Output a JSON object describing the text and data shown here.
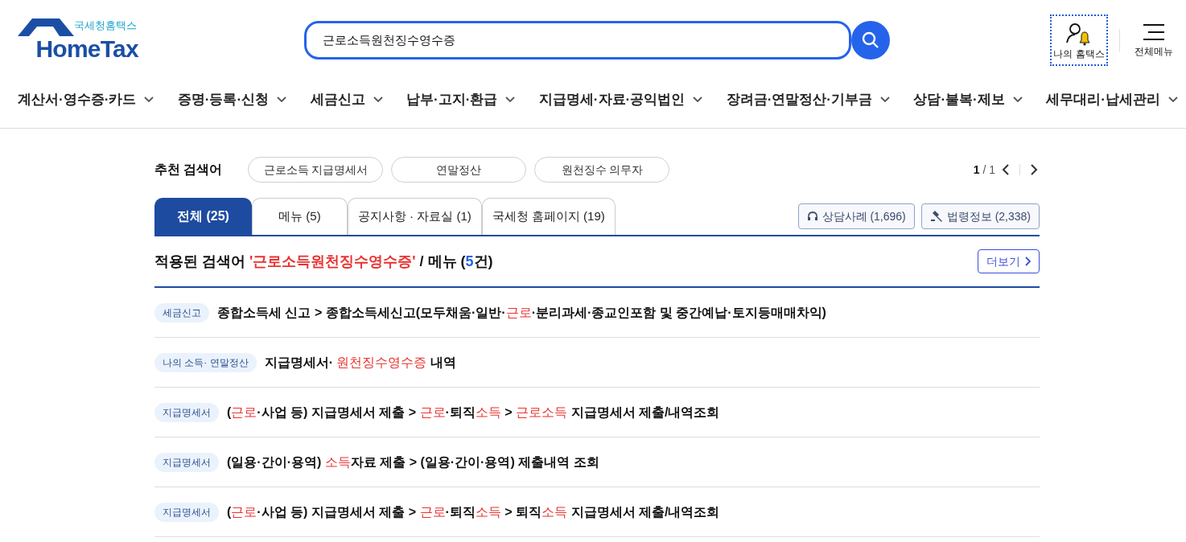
{
  "header": {
    "logo": {
      "subtitle": "국세청홈택스",
      "title": "HomeTax"
    },
    "search": {
      "value": "근로소득원천징수영수증"
    },
    "my_hometax": {
      "label": "나의 홈택스"
    },
    "all_menu": {
      "label": "전체메뉴"
    }
  },
  "nav": [
    "계산서·영수증·카드",
    "증명·등록·신청",
    "세금신고",
    "납부·고지·환급",
    "지급명세·자료·공익법인",
    "장려금·연말정산·기부금",
    "상담·불복·제보",
    "세무대리·납세관리"
  ],
  "recommended": {
    "label": "추천 검색어",
    "keywords": [
      "근로소득 지급명세서",
      "연말정산",
      "원천징수 의무자"
    ],
    "page_current": "1",
    "page_total": "/ 1"
  },
  "tabs": [
    {
      "label": "전체 (25)",
      "selected": true
    },
    {
      "label": "메뉴 (5)",
      "selected": false
    },
    {
      "label": "공지사항 · 자료실 (1)",
      "selected": false
    },
    {
      "label": "국세청 홈페이지 (19)",
      "selected": false
    }
  ],
  "side_buttons": [
    {
      "kind": "headset",
      "label": "상담사례 (1,696)"
    },
    {
      "kind": "gavel",
      "label": "법령정보 (2,338)"
    }
  ],
  "result_heading": [
    {
      "text": "적용된 검색어 ",
      "kind": "plain"
    },
    {
      "text": "'근로소득원천징수영수증'",
      "kind": "query"
    },
    {
      "text": " / 메뉴 (",
      "kind": "plain"
    },
    {
      "text": "5",
      "kind": "count"
    },
    {
      "text": "건)",
      "kind": "plain"
    }
  ],
  "more_button": "더보기",
  "results": [
    {
      "tag": "세금신고",
      "segments": [
        {
          "text": "종합소득세 신고 > 종합소득세신고(모두채움·일반·",
          "highlight": false
        },
        {
          "text": "근로",
          "highlight": true
        },
        {
          "text": "·분리과세·종교인포함 및 중간예납·토지등매매차익)",
          "highlight": false
        }
      ]
    },
    {
      "tag": "나의 소득· 연말정산",
      "segments": [
        {
          "text": "지급명세서· ",
          "highlight": false
        },
        {
          "text": "원천징수영수증",
          "highlight": true
        },
        {
          "text": " 내역",
          "highlight": false
        }
      ]
    },
    {
      "tag": "지급명세서",
      "segments": [
        {
          "text": "(",
          "highlight": false
        },
        {
          "text": "근로",
          "highlight": true
        },
        {
          "text": "·사업 등) 지급명세서 제출 > ",
          "highlight": false
        },
        {
          "text": "근로",
          "highlight": true
        },
        {
          "text": "·퇴직",
          "highlight": false
        },
        {
          "text": "소득",
          "highlight": true
        },
        {
          "text": " > ",
          "highlight": false
        },
        {
          "text": "근로소득",
          "highlight": true
        },
        {
          "text": " 지급명세서 제출/내역조회",
          "highlight": false
        }
      ]
    },
    {
      "tag": "지급명세서",
      "segments": [
        {
          "text": "(일용·간이·용역) ",
          "highlight": false
        },
        {
          "text": "소득",
          "highlight": true
        },
        {
          "text": "자료 제출 > (일용·간이·용역) 제출내역 조회",
          "highlight": false
        }
      ]
    },
    {
      "tag": "지급명세서",
      "segments": [
        {
          "text": "(",
          "highlight": false
        },
        {
          "text": "근로",
          "highlight": true
        },
        {
          "text": "·사업 등) 지급명세서 제출 > ",
          "highlight": false
        },
        {
          "text": "근로",
          "highlight": true
        },
        {
          "text": "·퇴직",
          "highlight": false
        },
        {
          "text": "소득",
          "highlight": true
        },
        {
          "text": " > 퇴직",
          "highlight": false
        },
        {
          "text": "소득",
          "highlight": true
        },
        {
          "text": " 지급명세서 제출/내역조회",
          "highlight": false
        }
      ]
    }
  ]
}
